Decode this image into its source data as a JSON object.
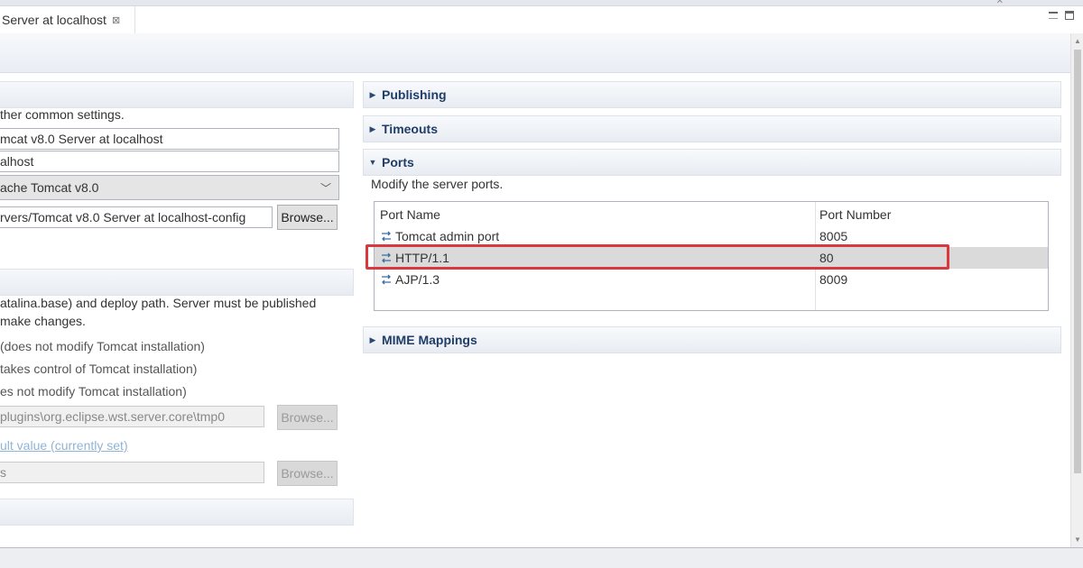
{
  "tab": {
    "title": "Server at localhost",
    "close_glyph": "⊠"
  },
  "left": {
    "general_desc": "ther common settings.",
    "server_name": "mcat v8.0 Server at localhost",
    "host_name": "alhost",
    "runtime": "ache Tomcat v8.0",
    "config_path": "rvers/Tomcat v8.0 Server at localhost-config",
    "browse_label": "Browse...",
    "locations_desc_line1": "atalina.base) and deploy path. Server must be published",
    "locations_desc_line2": "make changes.",
    "radio1": "(does not modify Tomcat installation)",
    "radio2": "takes control of Tomcat installation)",
    "radio3": "es not modify Tomcat installation)",
    "server_path": "plugins\\org.eclipse.wst.server.core\\tmp0",
    "default_link": "ult value (currently set)",
    "deploy_path": "s"
  },
  "right": {
    "sections": {
      "publishing": "Publishing",
      "timeouts": "Timeouts",
      "ports": "Ports",
      "mime": "MIME Mappings"
    },
    "ports_desc": "Modify the server ports.",
    "ports_table": {
      "headers": [
        "Port Name",
        "Port Number"
      ],
      "rows": [
        {
          "name": "Tomcat admin port",
          "number": "8005",
          "selected": false
        },
        {
          "name": "HTTP/1.1",
          "number": "80",
          "selected": true
        },
        {
          "name": "AJP/1.3",
          "number": "8009",
          "selected": false
        }
      ]
    }
  },
  "colors": {
    "section_title": "#1f3d66",
    "highlight": "#d9383e",
    "selected_row": "#dadada",
    "link": "#8fb4d6"
  },
  "icons": {
    "port_row": "port-icon",
    "expand": "triangle-right-icon",
    "collapse": "triangle-down-icon"
  }
}
